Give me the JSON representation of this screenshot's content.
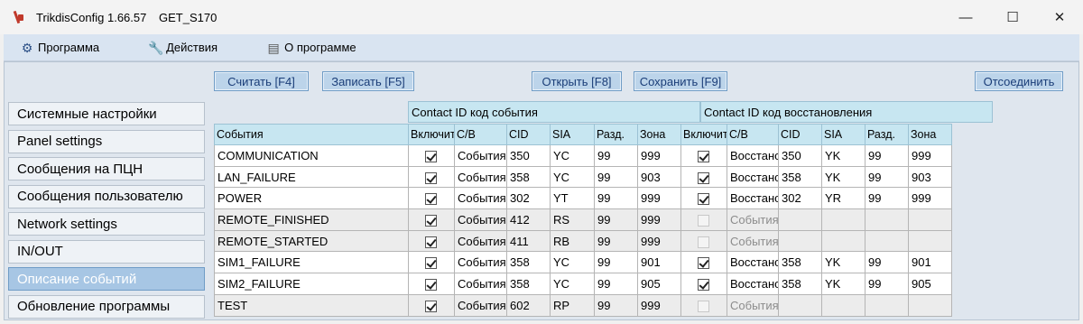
{
  "window": {
    "app_name": "TrikdisConfig 1.66.57",
    "device": "GET_S170",
    "minimize": "—",
    "maximize": "☐",
    "close": "✕"
  },
  "menu": {
    "program": "Программа",
    "actions": "Действия",
    "about": "О программе"
  },
  "toolbar": {
    "read": "Считать [F4]",
    "write": "Записать [F5]",
    "open": "Открыть [F8]",
    "save": "Сохранить [F9]",
    "disconnect": "Отсоединить"
  },
  "sidebar": {
    "items": [
      {
        "label": "Системные настройки",
        "active": false
      },
      {
        "label": "Panel settings",
        "active": false
      },
      {
        "label": "Сообщения на ПЦН",
        "active": false
      },
      {
        "label": "Сообщения пользователю",
        "active": false
      },
      {
        "label": "Network settings",
        "active": false
      },
      {
        "label": "IN/OUT",
        "active": false
      },
      {
        "label": "Описание событий",
        "active": true
      },
      {
        "label": "Обновление программы",
        "active": false
      }
    ]
  },
  "table": {
    "group_event": "Contact ID код события",
    "group_restore": "Contact ID код восстановления",
    "headers": [
      "События",
      "Включить",
      "C/B",
      "CID",
      "SIA",
      "Разд.",
      "Зона",
      "Включить",
      "C/B",
      "CID",
      "SIA",
      "Разд.",
      "Зона"
    ],
    "rows": [
      {
        "event": "COMMUNICATION",
        "ev_on": true,
        "ev_cb": "События",
        "ev_cid": "350",
        "ev_sia": "YC",
        "ev_part": "99",
        "ev_zone": "999",
        "rs_on": true,
        "rs_enabled": true,
        "rs_cb": "Восстановление",
        "rs_cid": "350",
        "rs_sia": "YK",
        "rs_part": "99",
        "rs_zone": "999"
      },
      {
        "event": "LAN_FAILURE",
        "ev_on": true,
        "ev_cb": "События",
        "ev_cid": "358",
        "ev_sia": "YC",
        "ev_part": "99",
        "ev_zone": "903",
        "rs_on": true,
        "rs_enabled": true,
        "rs_cb": "Восстановление",
        "rs_cid": "358",
        "rs_sia": "YK",
        "rs_part": "99",
        "rs_zone": "903"
      },
      {
        "event": "POWER",
        "ev_on": true,
        "ev_cb": "События",
        "ev_cid": "302",
        "ev_sia": "YT",
        "ev_part": "99",
        "ev_zone": "999",
        "rs_on": true,
        "rs_enabled": true,
        "rs_cb": "Восстановление",
        "rs_cid": "302",
        "rs_sia": "YR",
        "rs_part": "99",
        "rs_zone": "999"
      },
      {
        "event": "REMOTE_FINISHED",
        "ev_on": true,
        "ev_cb": "События",
        "ev_cid": "412",
        "ev_sia": "RS",
        "ev_part": "99",
        "ev_zone": "999",
        "rs_on": false,
        "rs_enabled": false,
        "rs_cb": "События",
        "rs_cid": "",
        "rs_sia": "",
        "rs_part": "",
        "rs_zone": ""
      },
      {
        "event": "REMOTE_STARTED",
        "ev_on": true,
        "ev_cb": "События",
        "ev_cid": "411",
        "ev_sia": "RB",
        "ev_part": "99",
        "ev_zone": "999",
        "rs_on": false,
        "rs_enabled": false,
        "rs_cb": "События",
        "rs_cid": "",
        "rs_sia": "",
        "rs_part": "",
        "rs_zone": ""
      },
      {
        "event": "SIM1_FAILURE",
        "ev_on": true,
        "ev_cb": "События",
        "ev_cid": "358",
        "ev_sia": "YC",
        "ev_part": "99",
        "ev_zone": "901",
        "rs_on": true,
        "rs_enabled": true,
        "rs_cb": "Восстановление",
        "rs_cid": "358",
        "rs_sia": "YK",
        "rs_part": "99",
        "rs_zone": "901"
      },
      {
        "event": "SIM2_FAILURE",
        "ev_on": true,
        "ev_cb": "События",
        "ev_cid": "358",
        "ev_sia": "YC",
        "ev_part": "99",
        "ev_zone": "905",
        "rs_on": true,
        "rs_enabled": true,
        "rs_cb": "Восстановление",
        "rs_cid": "358",
        "rs_sia": "YK",
        "rs_part": "99",
        "rs_zone": "905"
      },
      {
        "event": "TEST",
        "ev_on": true,
        "ev_cb": "События",
        "ev_cid": "602",
        "ev_sia": "RP",
        "ev_part": "99",
        "ev_zone": "999",
        "rs_on": false,
        "rs_enabled": false,
        "rs_cb": "События",
        "rs_cid": "",
        "rs_sia": "",
        "rs_part": "",
        "rs_zone": ""
      }
    ]
  }
}
